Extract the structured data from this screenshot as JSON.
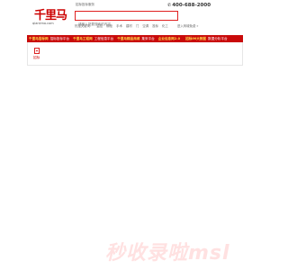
{
  "header": {
    "logo_text": "千里马",
    "logo_sub": "qianlima.com",
    "slogan": "招标投标服务",
    "phone": "400-688-2000",
    "phone_icon": "phone-icon"
  },
  "search": {
    "placeholder": "请输入您要搜索的内容"
  },
  "hot_keywords": [
    "热搜关键词：",
    "监控",
    "橱柜",
    "手术",
    "建材",
    "门",
    "空调",
    "投标",
    "化工"
  ],
  "right_link": "进入商城免费 »",
  "nav": [
    {
      "highlight": "千里马招标网",
      "text": "招标投标平台"
    },
    {
      "highlight": "千里马工程网",
      "text": "工程信息平台"
    },
    {
      "highlight": "千里马精品商城",
      "text": "集采平台"
    },
    {
      "highlight": "企业信息网2.0",
      "text": ""
    },
    {
      "highlight": "招标IM大数据",
      "text": "数据分析平台"
    }
  ],
  "panel": {
    "icon": "document-icon",
    "label": "招标"
  },
  "watermark": "秒收录啦msl"
}
